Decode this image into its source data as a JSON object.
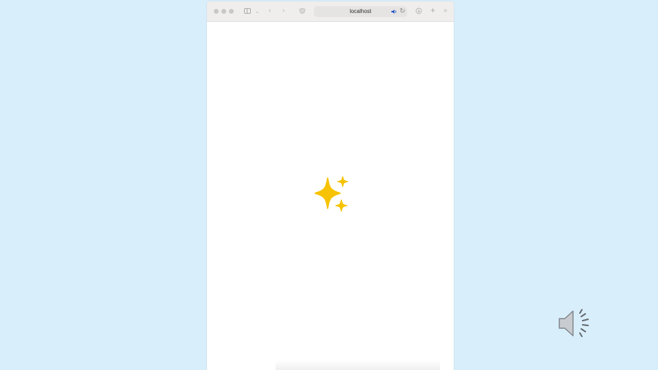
{
  "browser": {
    "address_bar": {
      "url": "localhost"
    },
    "icons": {
      "sidebar": "sidebar-icon",
      "back": "chevron-left-icon",
      "forward": "chevron-right-icon",
      "shield": "privacy-shield-icon",
      "audio": "speaker-playing-icon",
      "reload": "reload-icon",
      "downloads": "download-icon",
      "new_tab": "plus-icon",
      "more": "double-chevron-icon"
    }
  },
  "page": {
    "loading_icon": "sparkles-icon"
  },
  "slide": {
    "audio_icon": "speaker-icon"
  },
  "colors": {
    "slide_background": "#d8eefb",
    "sparkle": "#f7c300",
    "toolbar": "#f0eeec"
  }
}
